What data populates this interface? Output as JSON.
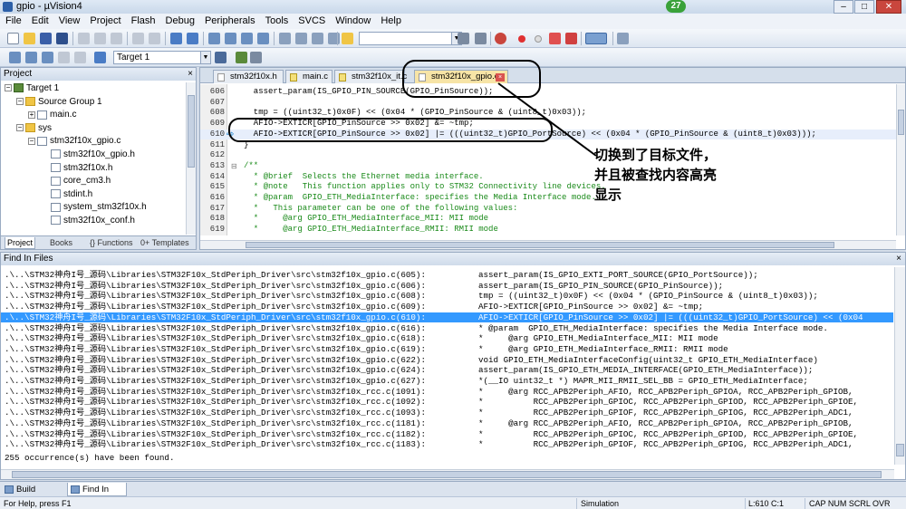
{
  "window": {
    "title": "gpio - µVision4",
    "badge": "27"
  },
  "menu": [
    "File",
    "Edit",
    "View",
    "Project",
    "Flash",
    "Debug",
    "Peripherals",
    "Tools",
    "SVCS",
    "Window",
    "Help"
  ],
  "toolbar": {
    "target_select": "Target 1"
  },
  "project_panel": {
    "title": "Project",
    "tree": [
      {
        "label": "Target 1",
        "type": "target",
        "toggle": "−",
        "depth": 0
      },
      {
        "label": "Source Group 1",
        "type": "folder",
        "toggle": "−",
        "depth": 1
      },
      {
        "label": "main.c",
        "type": "file",
        "toggle": "+",
        "depth": 2
      },
      {
        "label": "sys",
        "type": "folder",
        "toggle": "−",
        "depth": 1
      },
      {
        "label": "stm32f10x_gpio.c",
        "type": "file",
        "toggle": "−",
        "depth": 2
      },
      {
        "label": "stm32f10x_gpio.h",
        "type": "file",
        "toggle": "",
        "depth": 3
      },
      {
        "label": "stm32f10x.h",
        "type": "file",
        "toggle": "",
        "depth": 3
      },
      {
        "label": "core_cm3.h",
        "type": "file",
        "toggle": "",
        "depth": 3
      },
      {
        "label": "stdint.h",
        "type": "file",
        "toggle": "",
        "depth": 3
      },
      {
        "label": "system_stm32f10x.h",
        "type": "file",
        "toggle": "",
        "depth": 3
      },
      {
        "label": "stm32f10x_conf.h",
        "type": "file",
        "toggle": "",
        "depth": 3
      }
    ],
    "tabs": [
      "Project",
      "Books",
      "{} Functions",
      "0+ Templates"
    ]
  },
  "editor": {
    "tabs": [
      {
        "label": "stm32f10x.h",
        "active": false,
        "mod": false
      },
      {
        "label": "main.c",
        "active": false,
        "mod": true
      },
      {
        "label": "stm32f10x_it.c",
        "active": false,
        "mod": true
      },
      {
        "label": "stm32f10x_gpio.c",
        "active": true,
        "mod": false
      }
    ],
    "lines": [
      {
        "n": "606",
        "code": "  assert_param(IS_GPIO_PIN_SOURCE(GPIO_PinSource));",
        "cls": ""
      },
      {
        "n": "607",
        "code": "",
        "cls": ""
      },
      {
        "n": "608",
        "code": "  tmp = ((uint32_t)0x0F) << (0x04 * (GPIO_PinSource & (uint8_t)0x03));",
        "cls": ""
      },
      {
        "n": "609",
        "code": "  AFIO->EXTICR[GPIO_PinSource >> 0x02] &= ~tmp;",
        "cls": ""
      },
      {
        "n": "610",
        "code": "  AFIO->EXTICR[GPIO_PinSource >> 0x02] |= (((uint32_t)GPIO_PortSource) << (0x04 * (GPIO_PinSource & (uint8_t)0x03)));",
        "cls": "cur"
      },
      {
        "n": "611",
        "code": "}",
        "cls": ""
      },
      {
        "n": "612",
        "code": "",
        "cls": ""
      },
      {
        "n": "613",
        "code": "/**",
        "cls": "cm"
      },
      {
        "n": "614",
        "code": "  * @brief  Selects the Ethernet media interface.",
        "cls": "cm"
      },
      {
        "n": "615",
        "code": "  * @note   This function applies only to STM32 Connectivity line devices.",
        "cls": "cm"
      },
      {
        "n": "616",
        "code": "  * @param  GPIO_ETH_MediaInterface: specifies the Media Interface mode.",
        "cls": "cm"
      },
      {
        "n": "617",
        "code": "  *   This parameter can be one of the following values:",
        "cls": "cm"
      },
      {
        "n": "618",
        "code": "  *     @arg GPIO_ETH_MediaInterface_MII: MII mode",
        "cls": "cm"
      },
      {
        "n": "619",
        "code": "  *     @arg GPIO_ETH_MediaInterface_RMII: RMII mode",
        "cls": "cm"
      }
    ]
  },
  "annotation": {
    "line1": "切换到了目标文件，",
    "line2": "并且被查找内容高亮",
    "line3": "显示"
  },
  "find_panel": {
    "title": "Find In Files",
    "results": [
      {
        "path": ".\\..\\STM32神舟I号_源码\\Libraries\\STM32F10x_StdPeriph_Driver\\src\\stm32f10x_gpio.c(605):",
        "text": "assert_param(IS_GPIO_EXTI_PORT_SOURCE(GPIO_PortSource));"
      },
      {
        "path": ".\\..\\STM32神舟I号_源码\\Libraries\\STM32F10x_StdPeriph_Driver\\src\\stm32f10x_gpio.c(606):",
        "text": "assert_param(IS_GPIO_PIN_SOURCE(GPIO_PinSource));"
      },
      {
        "path": ".\\..\\STM32神舟I号_源码\\Libraries\\STM32F10x_StdPeriph_Driver\\src\\stm32f10x_gpio.c(608):",
        "text": "tmp = ((uint32_t)0x0F) << (0x04 * (GPIO_PinSource & (uint8_t)0x03));"
      },
      {
        "path": ".\\..\\STM32神舟I号_源码\\Libraries\\STM32F10x_StdPeriph_Driver\\src\\stm32f10x_gpio.c(609):",
        "text": "AFIO->EXTICR[GPIO_PinSource >> 0x02] &= ~tmp;"
      },
      {
        "path": ".\\..\\STM32神舟I号_源码\\Libraries\\STM32F10x_StdPeriph_Driver\\src\\stm32f10x_gpio.c(610):",
        "text": "AFIO->EXTICR[GPIO_PinSource >> 0x02] |= (((uint32_t)GPIO_PortSource) << (0x04"
      },
      {
        "path": ".\\..\\STM32神舟I号_源码\\Libraries\\STM32F10x_StdPeriph_Driver\\src\\stm32f10x_gpio.c(616):",
        "text": "* @param  GPIO_ETH_MediaInterface: specifies the Media Interface mode."
      },
      {
        "path": ".\\..\\STM32神舟I号_源码\\Libraries\\STM32F10x_StdPeriph_Driver\\src\\stm32f10x_gpio.c(618):",
        "text": "*     @arg GPIO_ETH_MediaInterface_MII: MII mode"
      },
      {
        "path": ".\\..\\STM32神舟I号_源码\\Libraries\\STM32F10x_StdPeriph_Driver\\src\\stm32f10x_gpio.c(619):",
        "text": "*     @arg GPIO_ETH_MediaInterface_RMII: RMII mode"
      },
      {
        "path": ".\\..\\STM32神舟I号_源码\\Libraries\\STM32F10x_StdPeriph_Driver\\src\\stm32f10x_gpio.c(622):",
        "text": "void GPIO_ETH_MediaInterfaceConfig(uint32_t GPIO_ETH_MediaInterface)"
      },
      {
        "path": ".\\..\\STM32神舟I号_源码\\Libraries\\STM32F10x_StdPeriph_Driver\\src\\stm32f10x_gpio.c(624):",
        "text": "assert_param(IS_GPIO_ETH_MEDIA_INTERFACE(GPIO_ETH_MediaInterface));"
      },
      {
        "path": ".\\..\\STM32神舟I号_源码\\Libraries\\STM32F10x_StdPeriph_Driver\\src\\stm32f10x_gpio.c(627):",
        "text": "*(__IO uint32_t *) MAPR_MII_RMII_SEL_BB = GPIO_ETH_MediaInterface;"
      },
      {
        "path": ".\\..\\STM32神舟I号_源码\\Libraries\\STM32F10x_StdPeriph_Driver\\src\\stm32f10x_rcc.c(1091):",
        "text": "*     @arg RCC_APB2Periph_AFIO, RCC_APB2Periph_GPIOA, RCC_APB2Periph_GPIOB,"
      },
      {
        "path": ".\\..\\STM32神舟I号_源码\\Libraries\\STM32F10x_StdPeriph_Driver\\src\\stm32f10x_rcc.c(1092):",
        "text": "*          RCC_APB2Periph_GPIOC, RCC_APB2Periph_GPIOD, RCC_APB2Periph_GPIOE,"
      },
      {
        "path": ".\\..\\STM32神舟I号_源码\\Libraries\\STM32F10x_StdPeriph_Driver\\src\\stm32f10x_rcc.c(1093):",
        "text": "*          RCC_APB2Periph_GPIOF, RCC_APB2Periph_GPIOG, RCC_APB2Periph_ADC1,"
      },
      {
        "path": ".\\..\\STM32神舟I号_源码\\Libraries\\STM32F10x_StdPeriph_Driver\\src\\stm32f10x_rcc.c(1181):",
        "text": "*     @arg RCC_APB2Periph_AFIO, RCC_APB2Periph_GPIOA, RCC_APB2Periph_GPIOB,"
      },
      {
        "path": ".\\..\\STM32神舟I号_源码\\Libraries\\STM32F10x_StdPeriph_Driver\\src\\stm32f10x_rcc.c(1182):",
        "text": "*          RCC_APB2Periph_GPIOC, RCC_APB2Periph_GPIOD, RCC_APB2Periph_GPIOE,"
      },
      {
        "path": ".\\..\\STM32神舟I号_源码\\Libraries\\STM32F10x_StdPeriph_Driver\\src\\stm32f10x_rcc.c(1183):",
        "text": "*          RCC_APB2Periph_GPIOF, RCC_APB2Periph_GPIOG, RCC_APB2Periph_ADC1,"
      }
    ],
    "selected_index": 4,
    "summary": "255 occurrence(s) have been found."
  },
  "output_tabs": [
    "Build Output",
    "Find In Files"
  ],
  "status": {
    "help": "For Help, press F1",
    "mode": "Simulation",
    "position": "L:610 C:1",
    "flags": "CAP  NUM  SCRL  OVR  R/W"
  }
}
